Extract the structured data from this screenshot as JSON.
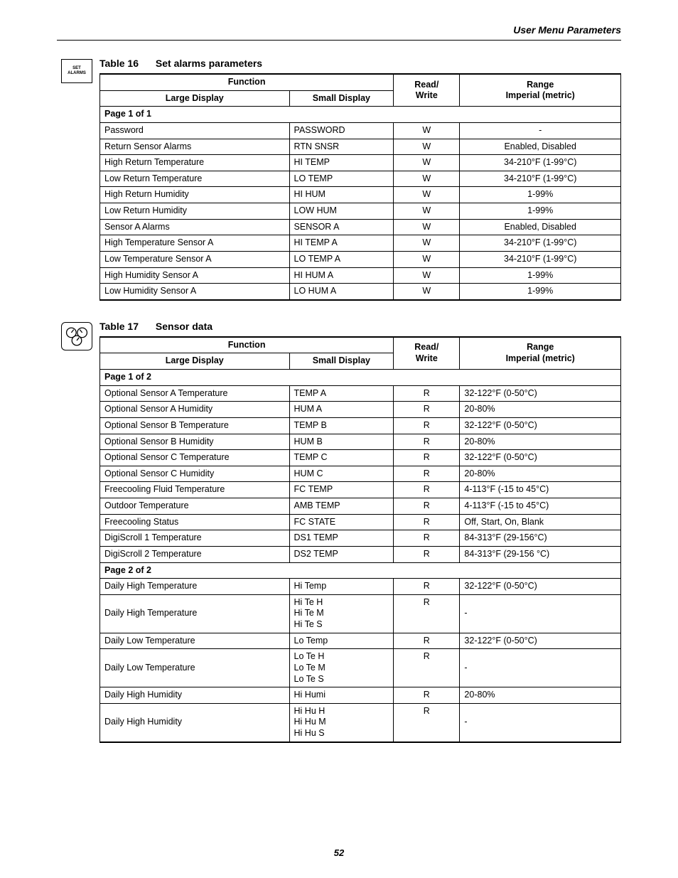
{
  "header": {
    "section": "User Menu Parameters"
  },
  "footer": {
    "page": "52"
  },
  "icons": {
    "set_alarms_line1": "SET",
    "set_alarms_line2": "ALARMS"
  },
  "table16": {
    "caption_num": "Table 16",
    "caption_title": "Set alarms parameters",
    "head_function": "Function",
    "head_large": "Large Display",
    "head_small": "Small Display",
    "head_rw1": "Read/",
    "head_rw2": "Write",
    "head_range1": "Range",
    "head_range2": "Imperial (metric)",
    "page_label": "Page 1 of 1",
    "rows": [
      {
        "large": "Password",
        "small": "PASSWORD",
        "rw": "W",
        "range": "-"
      },
      {
        "large": "Return Sensor Alarms",
        "small": "RTN SNSR",
        "rw": "W",
        "range": "Enabled, Disabled"
      },
      {
        "large": "High Return Temperature",
        "small": "HI TEMP",
        "rw": "W",
        "range": "34-210°F (1-99°C)"
      },
      {
        "large": "Low Return Temperature",
        "small": "LO TEMP",
        "rw": "W",
        "range": "34-210°F (1-99°C)"
      },
      {
        "large": "High Return Humidity",
        "small": "HI HUM",
        "rw": "W",
        "range": "1-99%"
      },
      {
        "large": "Low Return Humidity",
        "small": "LOW HUM",
        "rw": "W",
        "range": "1-99%"
      },
      {
        "large": "Sensor A Alarms",
        "small": "SENSOR A",
        "rw": "W",
        "range": "Enabled, Disabled"
      },
      {
        "large": "High Temperature Sensor A",
        "small": "HI TEMP A",
        "rw": "W",
        "range": "34-210°F (1-99°C)"
      },
      {
        "large": "Low Temperature Sensor A",
        "small": "LO TEMP A",
        "rw": "W",
        "range": "34-210°F (1-99°C)"
      },
      {
        "large": "High Humidity Sensor A",
        "small": "HI HUM A",
        "rw": "W",
        "range": "1-99%"
      },
      {
        "large": "Low Humidity Sensor A",
        "small": "LO HUM A",
        "rw": "W",
        "range": "1-99%"
      }
    ]
  },
  "table17": {
    "caption_num": "Table 17",
    "caption_title": "Sensor data",
    "head_function": "Function",
    "head_large": "Large Display",
    "head_small": "Small Display",
    "head_rw1": "Read/",
    "head_rw2": "Write",
    "head_range1": "Range",
    "head_range2": "Imperial (metric)",
    "page1_label": "Page 1 of 2",
    "page1_rows": [
      {
        "large": "Optional Sensor A Temperature",
        "small": "TEMP A",
        "rw": "R",
        "range": "32-122°F (0-50°C)"
      },
      {
        "large": "Optional Sensor A Humidity",
        "small": "HUM A",
        "rw": "R",
        "range": "20-80%"
      },
      {
        "large": "Optional Sensor B Temperature",
        "small": "TEMP B",
        "rw": "R",
        "range": "32-122°F (0-50°C)"
      },
      {
        "large": "Optional Sensor B Humidity",
        "small": "HUM B",
        "rw": "R",
        "range": "20-80%"
      },
      {
        "large": "Optional Sensor C Temperature",
        "small": "TEMP C",
        "rw": "R",
        "range": "32-122°F (0-50°C)"
      },
      {
        "large": "Optional Sensor C Humidity",
        "small": "HUM C",
        "rw": "R",
        "range": "20-80%"
      },
      {
        "large": "Freecooling Fluid Temperature",
        "small": "FC TEMP",
        "rw": "R",
        "range": "4-113°F (-15 to 45°C)"
      },
      {
        "large": "Outdoor Temperature",
        "small": "AMB TEMP",
        "rw": "R",
        "range": "4-113°F (-15 to 45°C)"
      },
      {
        "large": "Freecooling Status",
        "small": "FC STATE",
        "rw": "R",
        "range": "Off, Start, On, Blank"
      },
      {
        "large": "DigiScroll 1 Temperature",
        "small": "DS1 TEMP",
        "rw": "R",
        "range": "84-313°F (29-156°C)"
      },
      {
        "large": "DigiScroll 2 Temperature",
        "small": "DS2 TEMP",
        "rw": "R",
        "range": "84-313°F (29-156 °C)"
      }
    ],
    "page2_label": "Page 2 of 2",
    "page2_rows": [
      {
        "large": "Daily High Temperature",
        "small": "Hi Temp",
        "rw": "R",
        "range": "32-122°F (0-50°C)"
      },
      {
        "large": "Daily High Temperature",
        "small_lines": [
          "Hi Te H",
          "Hi Te M",
          "Hi Te S"
        ],
        "rw": "R",
        "range": "-"
      },
      {
        "large": "Daily Low Temperature",
        "small": "Lo Temp",
        "rw": "R",
        "range": "32-122°F (0-50°C)"
      },
      {
        "large": "Daily Low Temperature",
        "small_lines": [
          "Lo Te H",
          "Lo Te M",
          "Lo Te S"
        ],
        "rw": "R",
        "range": "-"
      },
      {
        "large": "Daily High Humidity",
        "small": "Hi Humi",
        "rw": "R",
        "range": "20-80%"
      },
      {
        "large": "Daily High Humidity",
        "small_lines": [
          "Hi Hu H",
          "Hi Hu M",
          "Hi Hu S"
        ],
        "rw": "R",
        "range": "-"
      }
    ]
  }
}
